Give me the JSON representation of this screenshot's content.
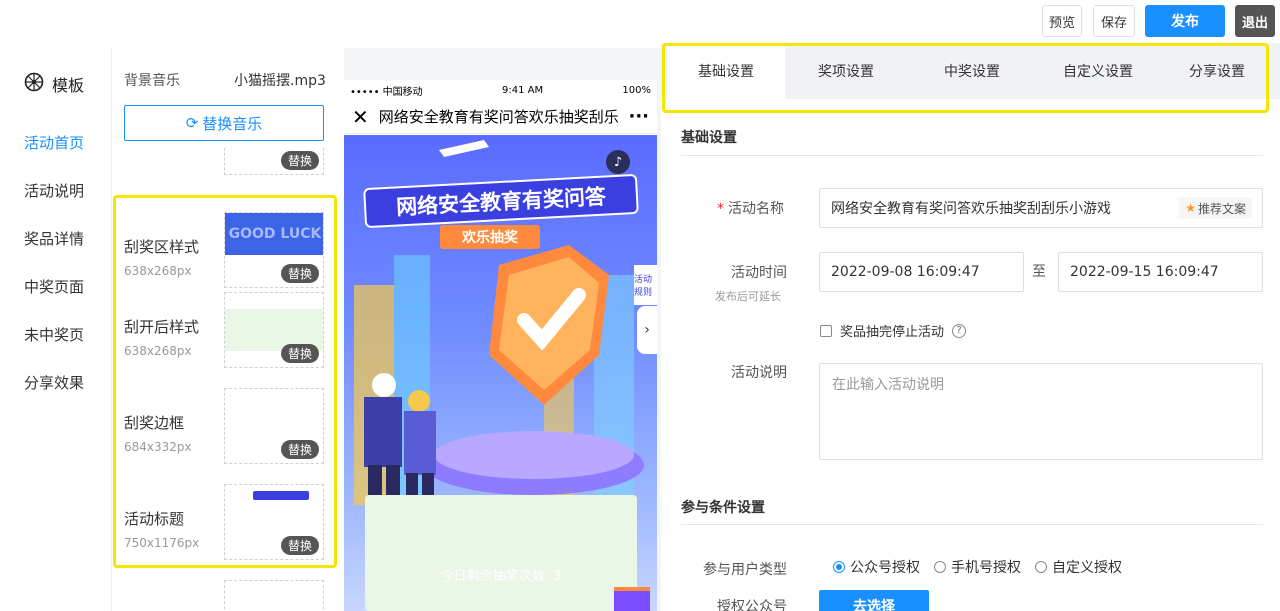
{
  "toolbar": {
    "preview_label": "预览",
    "save_label": "保存",
    "publish_label": "发布",
    "exit_label": "退出",
    "publish_color": "#1890ff"
  },
  "leftnav": {
    "header": "模板",
    "header_icon": "wheel-icon",
    "items": [
      {
        "label": "活动首页",
        "active": true
      },
      {
        "label": "活动说明"
      },
      {
        "label": "奖品详情"
      },
      {
        "label": "中奖页面"
      },
      {
        "label": "未中奖页"
      },
      {
        "label": "分享效果"
      }
    ]
  },
  "materials": {
    "music_label": "背景音乐",
    "music_name": "小猫摇摆.mp3",
    "replace_music_label": "替换音乐",
    "replace_label": "替换",
    "items": [
      {
        "name": "刮奖区样式",
        "size": "638x268px",
        "thumb_text": "GOOD LUCK"
      },
      {
        "name": "刮开后样式",
        "size": "638x268px"
      },
      {
        "name": "刮奖边框",
        "size": "684x332px"
      },
      {
        "name": "活动标题",
        "size": "750x1176px"
      }
    ]
  },
  "phone": {
    "carrier": "••••• 中国移动",
    "time": "9:41 AM",
    "battery": "100%",
    "title": "网络安全教育有奖问答欢乐抽奖刮乐小游戏",
    "banner_title": "网络安全教育有奖问答",
    "banner_sub": "欢乐抽奖",
    "side_tab": "活动规则",
    "scratch_text": "今日剩余抽奖次数: 3"
  },
  "settings": {
    "tabs": [
      {
        "label": "基础设置",
        "active": true
      },
      {
        "label": "奖项设置"
      },
      {
        "label": "中奖设置"
      },
      {
        "label": "自定义设置"
      },
      {
        "label": "分享设置"
      }
    ],
    "section_basic": "基础设置",
    "name_label": "活动名称",
    "name_value": "网络安全教育有奖问答欢乐抽奖刮刮乐小游戏",
    "recommend_label": "推荐文案",
    "time_label": "活动时间",
    "time_hint": "发布后可延长",
    "start_time": "2022-09-08 16:09:47",
    "to_label": "至",
    "end_time": "2022-09-15 16:09:47",
    "stop_checkbox_label": "奖品抽完停止活动",
    "desc_label": "活动说明",
    "desc_placeholder": "在此输入活动说明",
    "section_participation": "参与条件设置",
    "user_type_label": "参与用户类型",
    "user_types": [
      "公众号授权",
      "手机号授权",
      "自定义授权"
    ],
    "selected_user_type": "公众号授权",
    "auth_label": "授权公众号",
    "choose_button": "去选择"
  }
}
